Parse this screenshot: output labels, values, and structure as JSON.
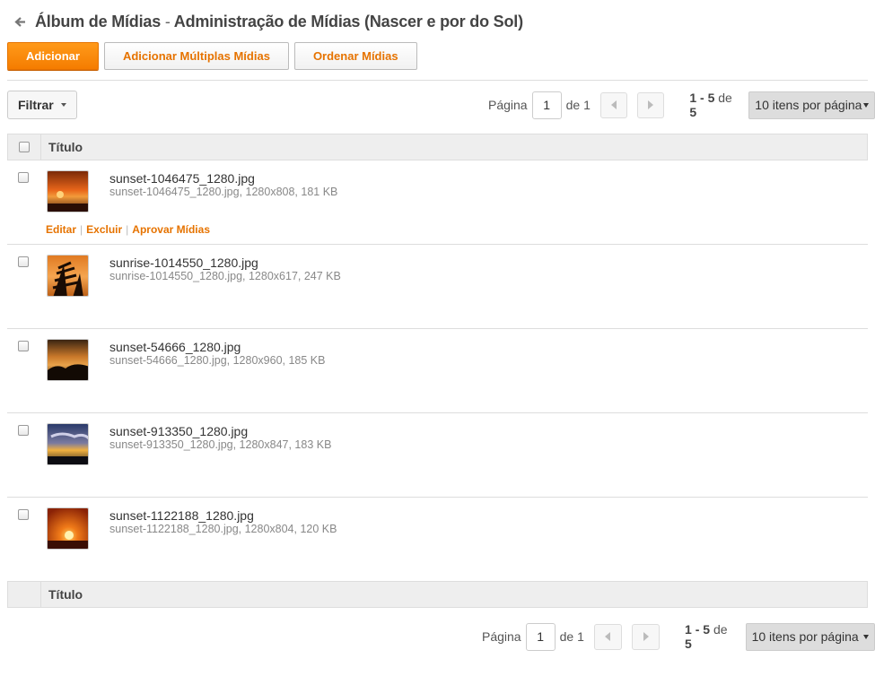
{
  "header": {
    "album_label": "Álbum de Mídias",
    "separator": "-",
    "admin_label": "Administração de Mídias (Nascer e por do Sol)"
  },
  "toolbar": {
    "add_label": "Adicionar",
    "add_multiple_label": "Adicionar Múltiplas Mídias",
    "order_label": "Ordenar Mídias"
  },
  "filter": {
    "label": "Filtrar"
  },
  "pagination": {
    "page_label": "Página",
    "current_page": "1",
    "of_label": "de",
    "total_pages": "1",
    "range_start_end": "1 - 5",
    "range_of": "de",
    "total_items": "5",
    "per_page": "10 itens por página"
  },
  "table": {
    "column_title": "Título",
    "rows": [
      {
        "name": "sunset-1046475_1280.jpg",
        "meta": "sunset-1046475_1280.jpg, 1280x808, 181 KB"
      },
      {
        "name": "sunrise-1014550_1280.jpg",
        "meta": "sunrise-1014550_1280.jpg, 1280x617, 247 KB"
      },
      {
        "name": "sunset-54666_1280.jpg",
        "meta": "sunset-54666_1280.jpg, 1280x960, 185 KB"
      },
      {
        "name": "sunset-913350_1280.jpg",
        "meta": "sunset-913350_1280.jpg, 1280x847, 183 KB"
      },
      {
        "name": "sunset-1122188_1280.jpg",
        "meta": "sunset-1122188_1280.jpg, 1280x804, 120 KB"
      }
    ],
    "row_actions": {
      "edit": "Editar",
      "delete": "Excluir",
      "approve": "Aprovar Mídias",
      "divider": "|"
    }
  },
  "colors": {
    "accent": "#f57c00",
    "link": "#e67300",
    "header_bg": "#eeeeee"
  }
}
